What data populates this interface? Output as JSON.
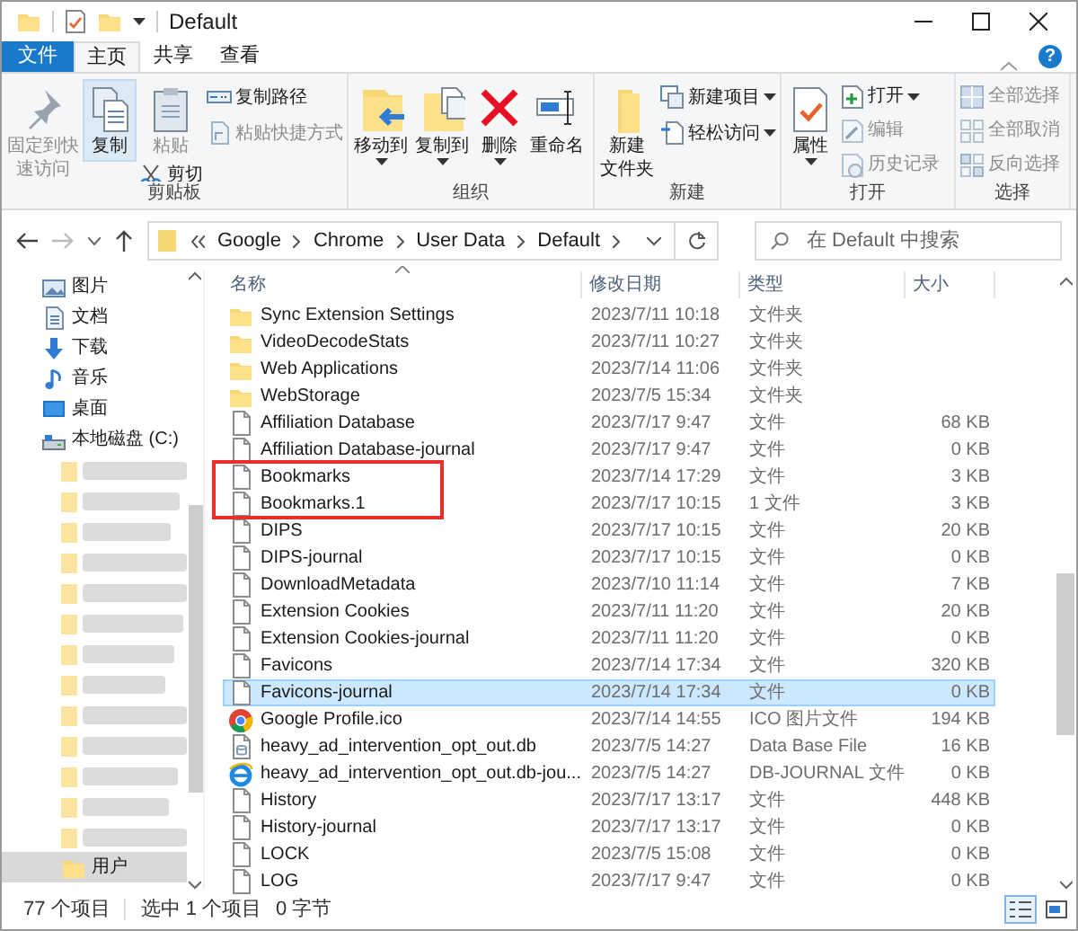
{
  "window": {
    "title": "Default"
  },
  "tabs": [
    {
      "label": "文件",
      "kind": "file",
      "selected": false
    },
    {
      "label": "主页",
      "kind": "tab",
      "selected": true
    },
    {
      "label": "共享",
      "kind": "tab",
      "selected": false
    },
    {
      "label": "查看",
      "kind": "tab",
      "selected": false
    }
  ],
  "help_button": "?",
  "ribbon": {
    "groups": [
      {
        "label": "剪贴板",
        "columns": [
          [
            {
              "kind": "large",
              "label_lines": [
                "固定到快",
                "速访问"
              ],
              "disabled": true,
              "highlighted": false,
              "dropdown": false
            }
          ],
          [
            {
              "kind": "large",
              "label_lines": [
                "复制"
              ],
              "disabled": false,
              "highlighted": true,
              "dropdown": false
            }
          ],
          [
            {
              "kind": "large",
              "label_lines": [
                "粘贴"
              ],
              "disabled": true,
              "highlighted": false,
              "dropdown": false
            },
            {
              "kind": "small",
              "label": "剪切",
              "disabled": false,
              "dropdown": false
            }
          ],
          [
            {
              "kind": "small",
              "label": "复制路径",
              "disabled": false,
              "dropdown": false
            },
            {
              "kind": "small",
              "label": "粘贴快捷方式",
              "disabled": true,
              "dropdown": false
            }
          ]
        ]
      },
      {
        "label": "组织",
        "columns": [
          [
            {
              "kind": "large",
              "label_lines": [
                "移动到"
              ],
              "disabled": false,
              "highlighted": false,
              "dropdown": true
            }
          ],
          [
            {
              "kind": "large",
              "label_lines": [
                "复制到"
              ],
              "disabled": false,
              "highlighted": false,
              "dropdown": true
            }
          ],
          [
            {
              "kind": "large",
              "label_lines": [
                "删除"
              ],
              "disabled": false,
              "highlighted": false,
              "dropdown": true
            }
          ],
          [
            {
              "kind": "large",
              "label_lines": [
                "重命名"
              ],
              "disabled": false,
              "highlighted": false,
              "dropdown": false
            }
          ]
        ]
      },
      {
        "label": "新建",
        "columns": [
          [
            {
              "kind": "large",
              "label_lines": [
                "新建",
                "文件夹"
              ],
              "disabled": false,
              "highlighted": false,
              "dropdown": false
            }
          ],
          [
            {
              "kind": "small",
              "label": "新建项目",
              "disabled": false,
              "dropdown": true
            },
            {
              "kind": "small",
              "label": "轻松访问",
              "disabled": false,
              "dropdown": true
            }
          ]
        ]
      },
      {
        "label": "打开",
        "columns": [
          [
            {
              "kind": "large",
              "label_lines": [
                "属性"
              ],
              "disabled": false,
              "highlighted": false,
              "dropdown": true
            }
          ],
          [
            {
              "kind": "small",
              "label": "打开",
              "disabled": false,
              "dropdown": true
            },
            {
              "kind": "small",
              "label": "编辑",
              "disabled": true,
              "dropdown": false
            },
            {
              "kind": "small",
              "label": "历史记录",
              "disabled": true,
              "dropdown": false
            }
          ]
        ]
      },
      {
        "label": "选择",
        "columns": [
          [
            {
              "kind": "small",
              "label": "全部选择",
              "disabled": true,
              "dropdown": false
            },
            {
              "kind": "small",
              "label": "全部取消",
              "disabled": true,
              "dropdown": false
            },
            {
              "kind": "small",
              "label": "反向选择",
              "disabled": true,
              "dropdown": false
            }
          ]
        ]
      }
    ]
  },
  "address": {
    "path": [
      "Google",
      "Chrome",
      "User Data",
      "Default"
    ]
  },
  "search": {
    "placeholder": "在 Default 中搜索"
  },
  "sidebar": {
    "items": [
      {
        "kind": "pictures",
        "label": "图片",
        "selected": false
      },
      {
        "kind": "documents",
        "label": "文档",
        "selected": false
      },
      {
        "kind": "downloads",
        "label": "下载",
        "selected": false
      },
      {
        "kind": "music",
        "label": "音乐",
        "selected": false
      },
      {
        "kind": "desktop",
        "label": "桌面",
        "selected": false
      },
      {
        "kind": "drive",
        "label": "本地磁盘 (C:)",
        "selected": false
      },
      {
        "kind": "redacted",
        "selected": false
      },
      {
        "kind": "redacted",
        "selected": false
      },
      {
        "kind": "redacted",
        "selected": false
      },
      {
        "kind": "redacted",
        "selected": false
      },
      {
        "kind": "redacted",
        "selected": false
      },
      {
        "kind": "redacted",
        "selected": false
      },
      {
        "kind": "redacted",
        "selected": false
      },
      {
        "kind": "redacted",
        "selected": false
      },
      {
        "kind": "redacted",
        "selected": false
      },
      {
        "kind": "redacted",
        "selected": false
      },
      {
        "kind": "redacted",
        "selected": false
      },
      {
        "kind": "redacted",
        "selected": false
      },
      {
        "kind": "redacted",
        "selected": false
      },
      {
        "kind": "folder",
        "label": "用户",
        "selected": true
      }
    ]
  },
  "table": {
    "columns": [
      "名称",
      "修改日期",
      "类型",
      "大小"
    ],
    "rows": [
      {
        "kind": "folder",
        "name": "Sync Extension Settings",
        "date": "2023/7/11 10:18",
        "type": "文件夹",
        "selected": false,
        "marked": false
      },
      {
        "kind": "folder",
        "name": "VideoDecodeStats",
        "date": "2023/7/11 10:27",
        "type": "文件夹",
        "selected": false,
        "marked": false
      },
      {
        "kind": "folder",
        "name": "Web Applications",
        "date": "2023/7/14 11:06",
        "type": "文件夹",
        "selected": false,
        "marked": false
      },
      {
        "kind": "folder",
        "name": "WebStorage",
        "date": "2023/7/5 15:34",
        "type": "文件夹",
        "selected": false,
        "marked": false
      },
      {
        "kind": "file",
        "name": "Affiliation Database",
        "date": "2023/7/17 9:47",
        "type": "文件",
        "size": "68 KB",
        "selected": false,
        "marked": false
      },
      {
        "kind": "file",
        "name": "Affiliation Database-journal",
        "date": "2023/7/17 9:47",
        "type": "文件",
        "size": "0 KB",
        "selected": false,
        "marked": false
      },
      {
        "kind": "file",
        "name": "Bookmarks",
        "date": "2023/7/14 17:29",
        "type": "文件",
        "size": "3 KB",
        "selected": false,
        "marked": true
      },
      {
        "kind": "file",
        "name": "Bookmarks.1",
        "date": "2023/7/17 10:15",
        "type": "1 文件",
        "size": "3 KB",
        "selected": false,
        "marked": true
      },
      {
        "kind": "file",
        "name": "DIPS",
        "date": "2023/7/17 10:15",
        "type": "文件",
        "size": "20 KB",
        "selected": false,
        "marked": false
      },
      {
        "kind": "file",
        "name": "DIPS-journal",
        "date": "2023/7/17 10:15",
        "type": "文件",
        "size": "0 KB",
        "selected": false,
        "marked": false
      },
      {
        "kind": "file",
        "name": "DownloadMetadata",
        "date": "2023/7/10 11:14",
        "type": "文件",
        "size": "7 KB",
        "selected": false,
        "marked": false
      },
      {
        "kind": "file",
        "name": "Extension Cookies",
        "date": "2023/7/11 11:20",
        "type": "文件",
        "size": "20 KB",
        "selected": false,
        "marked": false
      },
      {
        "kind": "file",
        "name": "Extension Cookies-journal",
        "date": "2023/7/11 11:20",
        "type": "文件",
        "size": "0 KB",
        "selected": false,
        "marked": false
      },
      {
        "kind": "file",
        "name": "Favicons",
        "date": "2023/7/14 17:34",
        "type": "文件",
        "size": "320 KB",
        "selected": false,
        "marked": false
      },
      {
        "kind": "file",
        "name": "Favicons-journal",
        "date": "2023/7/14 17:34",
        "type": "文件",
        "size": "0 KB",
        "selected": true,
        "marked": false
      },
      {
        "kind": "chrome",
        "name": "Google Profile.ico",
        "date": "2023/7/14 14:55",
        "type": "ICO 图片文件",
        "size": "194 KB",
        "selected": false,
        "marked": false
      },
      {
        "kind": "database",
        "name": "heavy_ad_intervention_opt_out.db",
        "date": "2023/7/5 14:27",
        "type": "Data Base File",
        "size": "16 KB",
        "selected": false,
        "marked": false
      },
      {
        "kind": "ie",
        "name": "heavy_ad_intervention_opt_out.db-jou...",
        "date": "2023/7/5 14:27",
        "type": "DB-JOURNAL 文件",
        "size": "0 KB",
        "selected": false,
        "marked": false
      },
      {
        "kind": "file",
        "name": "History",
        "date": "2023/7/17 13:17",
        "type": "文件",
        "size": "448 KB",
        "selected": false,
        "marked": false
      },
      {
        "kind": "file",
        "name": "History-journal",
        "date": "2023/7/17 13:17",
        "type": "文件",
        "size": "0 KB",
        "selected": false,
        "marked": false
      },
      {
        "kind": "file",
        "name": "LOCK",
        "date": "2023/7/5 15:08",
        "type": "文件",
        "size": "0 KB",
        "selected": false,
        "marked": false
      },
      {
        "kind": "file",
        "name": "LOG",
        "date": "2023/7/17 9:47",
        "type": "文件",
        "size": "0 KB",
        "selected": false,
        "marked": false
      }
    ]
  },
  "status_bar": {
    "item_count": "77 个项目",
    "selection": "选中 1 个项目",
    "selection_size": "0 字节"
  },
  "view_buttons": [
    {
      "kind": "details",
      "selected": true
    },
    {
      "kind": "thumbnails",
      "selected": false
    }
  ]
}
